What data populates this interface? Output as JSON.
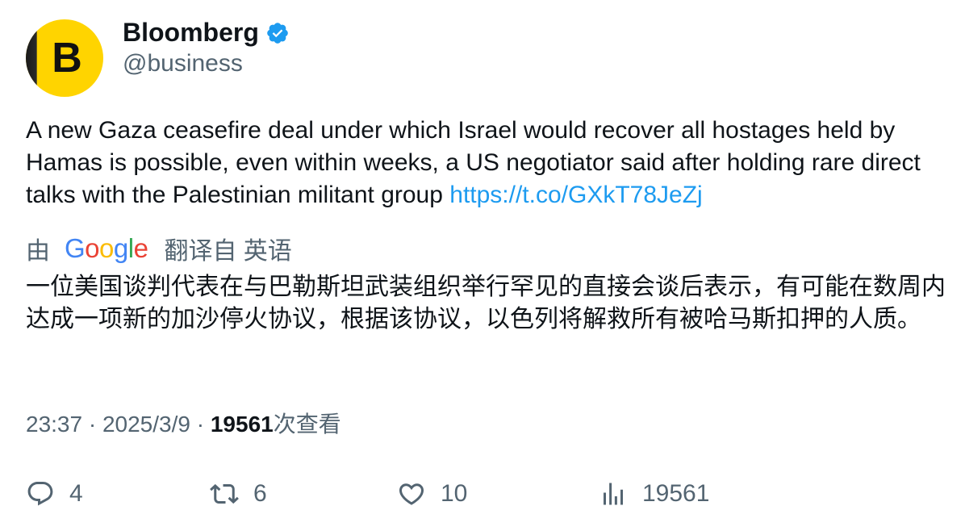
{
  "author": {
    "avatar_letter": "B",
    "name": "Bloomberg",
    "handle": "@business",
    "verified": true,
    "brand_color": "#ffd400"
  },
  "tweet": {
    "text": "A new Gaza ceasefire deal under which Israel would recover all hostages held by Hamas is possible, even within weeks, a US negotiator said after holding rare direct talks with the Palestinian militant group ",
    "link": "https://t.co/GXkT78JeZj",
    "link_color": "#1d9bf0"
  },
  "translation": {
    "prefix": "由",
    "provider": "Google",
    "suffix": "翻译自 英语",
    "text": "一位美国谈判代表在与巴勒斯坦武装组织举行罕见的直接会谈后表示，有可能在数周内达成一项新的加沙停火协议，根据该协议，以色列将解救所有被哈马斯扣押的人质。"
  },
  "meta": {
    "time": "23:37",
    "separator": "·",
    "date": "2025/3/9",
    "views_count": "19561",
    "views_label": "次查看"
  },
  "actions": {
    "reply": {
      "icon": "reply-icon",
      "count": "4"
    },
    "retweet": {
      "icon": "retweet-icon",
      "count": "6"
    },
    "like": {
      "icon": "heart-icon",
      "count": "10"
    },
    "views": {
      "icon": "analytics-icon",
      "count": "19561"
    }
  }
}
